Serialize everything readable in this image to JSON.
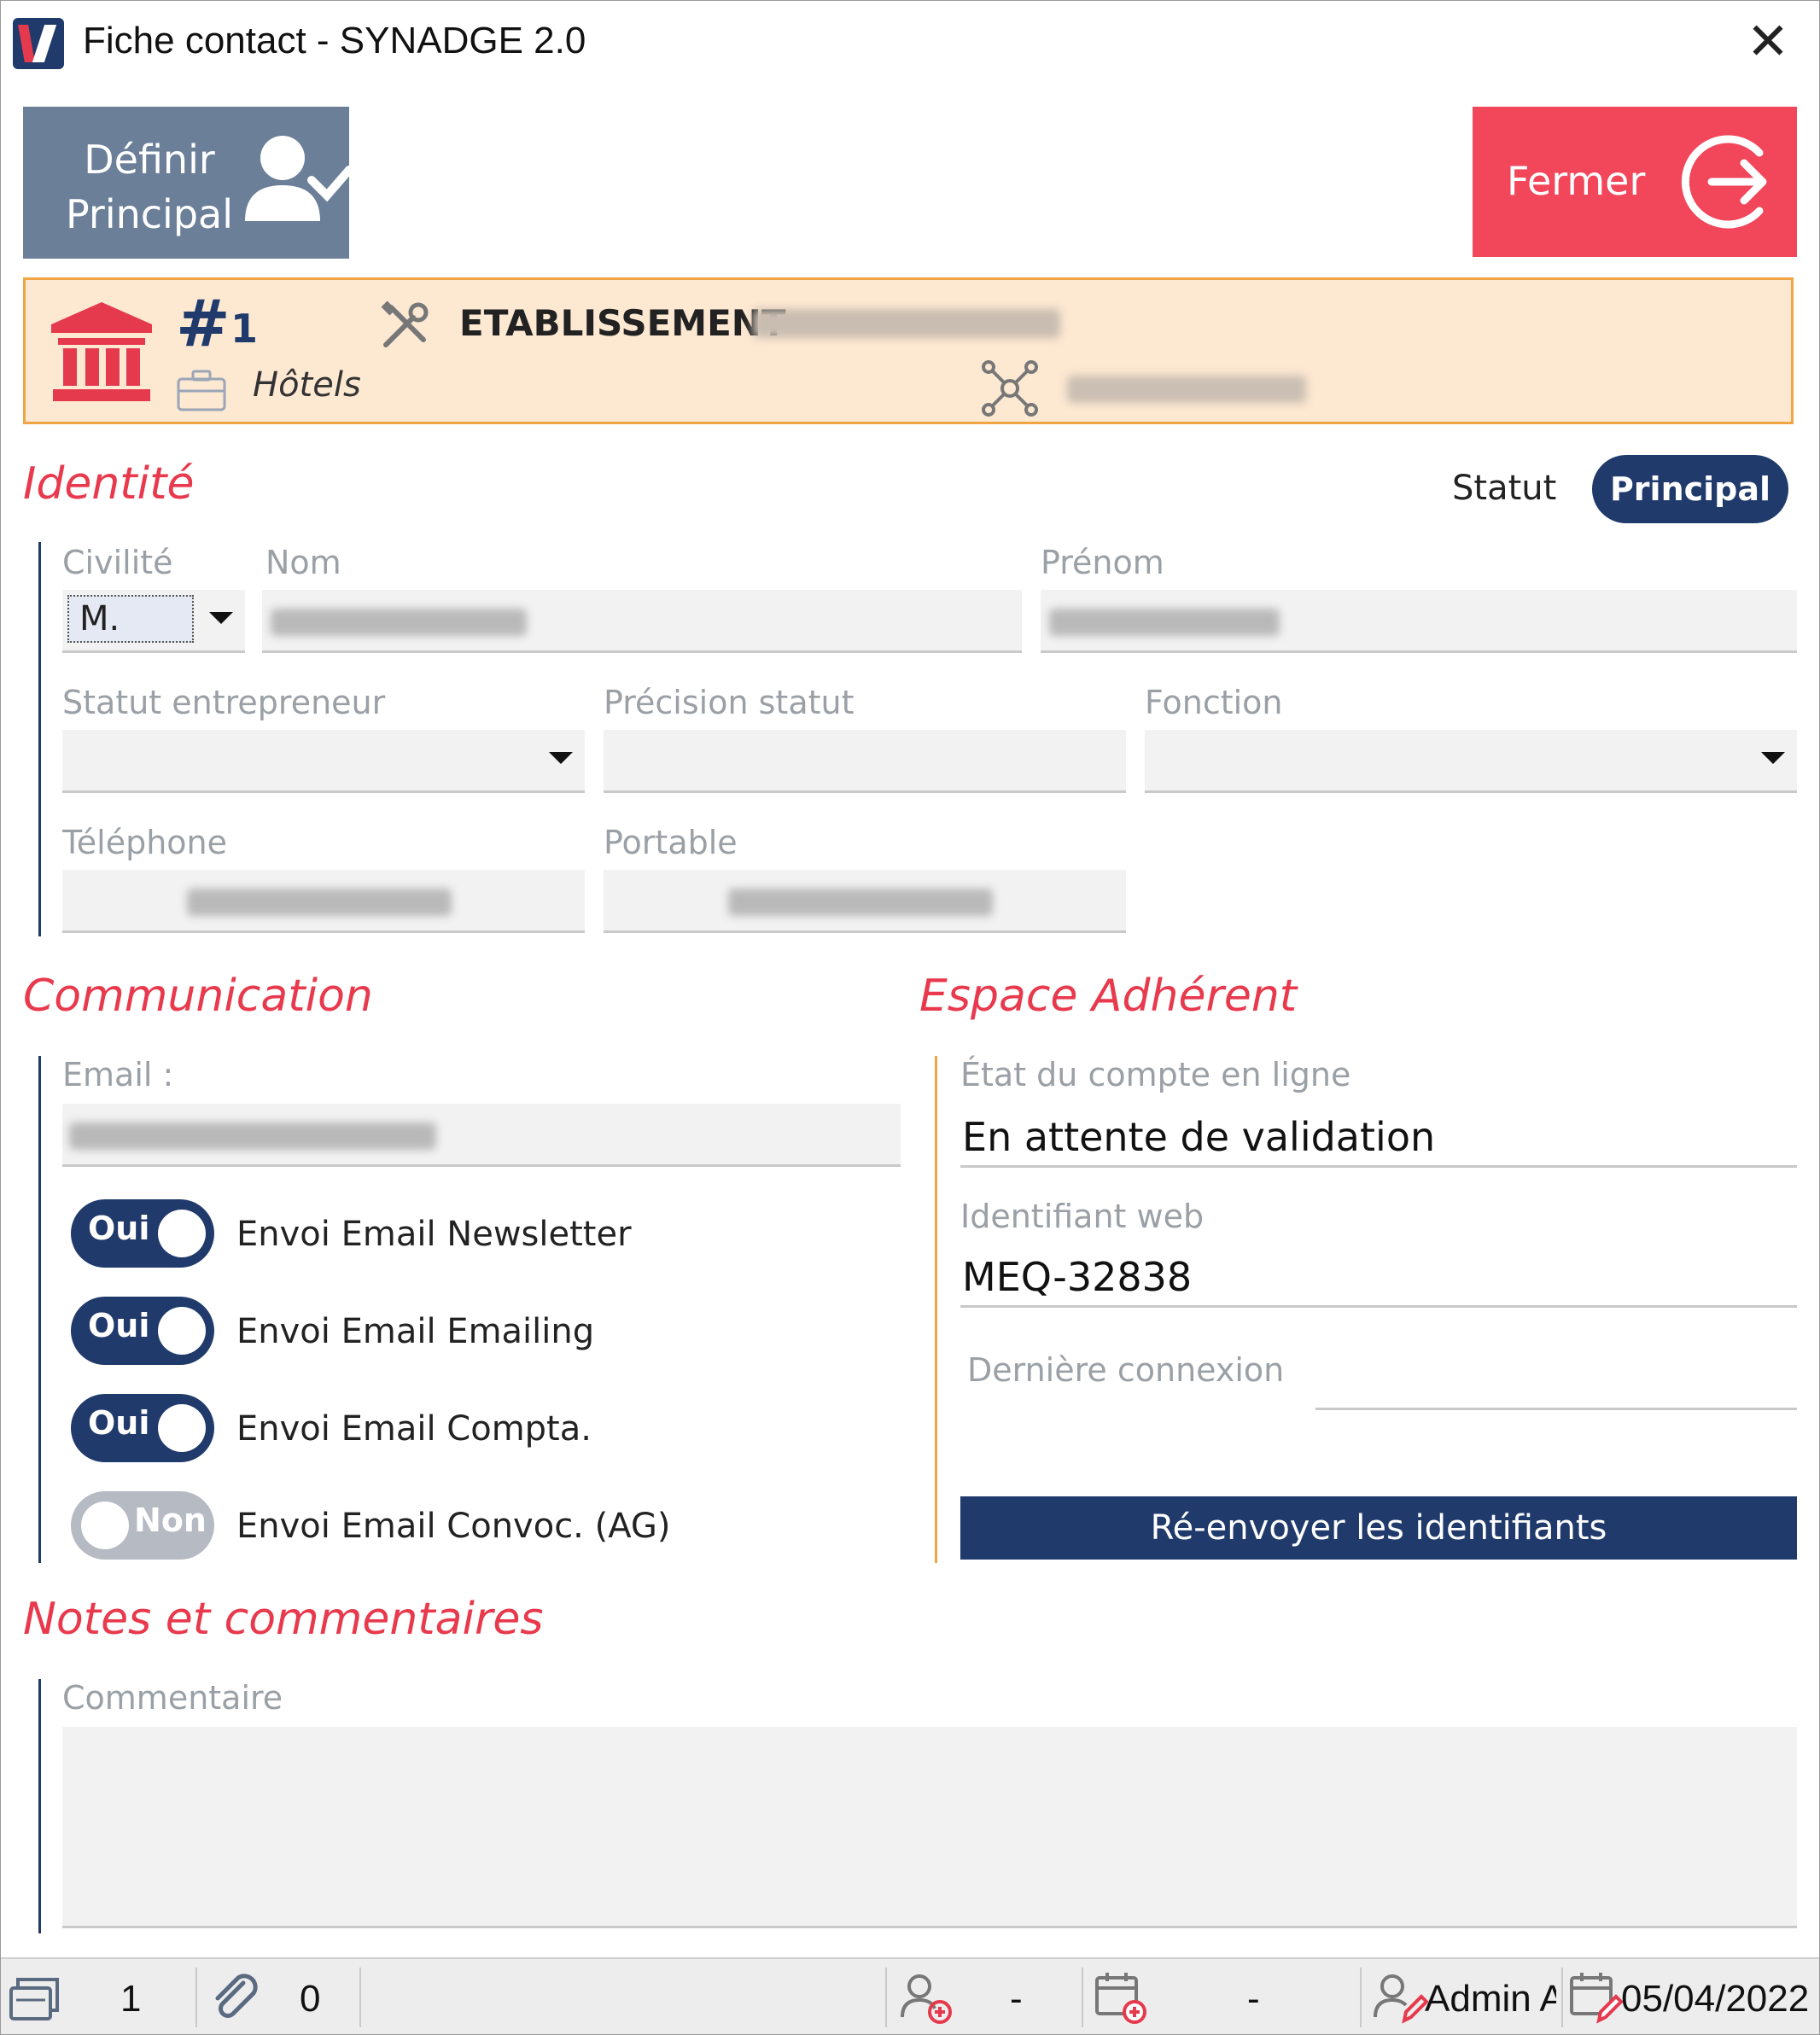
{
  "window": {
    "title": "Fiche contact - SYNADGE 2.0"
  },
  "toolbar": {
    "principal_line1": "Définir",
    "principal_line2": "Principal",
    "fermer_label": "Fermer"
  },
  "etablissement": {
    "hash": "#",
    "number": "1",
    "category": "Hôtels",
    "label": "ETABLISSEMENT"
  },
  "identite": {
    "section_title": "Identité",
    "statut_label": "Statut",
    "statut_value": "Principal",
    "civilite_label": "Civilité",
    "civilite_value": "M.",
    "nom_label": "Nom",
    "prenom_label": "Prénom",
    "statut_entrepreneur_label": "Statut entrepreneur",
    "precision_statut_label": "Précision statut",
    "fonction_label": "Fonction",
    "telephone_label": "Téléphone",
    "portable_label": "Portable"
  },
  "communication": {
    "section_title": "Communication",
    "email_label": "Email :",
    "toggles": [
      {
        "state": "Oui",
        "label": "Envoi Email Newsletter"
      },
      {
        "state": "Oui",
        "label": "Envoi Email Emailing"
      },
      {
        "state": "Oui",
        "label": "Envoi Email Compta."
      },
      {
        "state": "Non",
        "label": "Envoi Email Convoc. (AG)"
      }
    ]
  },
  "espace": {
    "section_title": "Espace Adhérent",
    "etat_label": "État du compte en ligne",
    "etat_value": "En attente de validation",
    "identifiant_label": "Identifiant web",
    "identifiant_value": "MEQ-32838",
    "derniere_label": "Dernière connexion",
    "resend_label": "Ré-envoyer les identifiants"
  },
  "notes": {
    "section_title": "Notes et commentaires",
    "commentaire_label": "Commentaire"
  },
  "statusbar": {
    "documents_count": "1",
    "attachments_count": "0",
    "created_by": "-",
    "created_date": "-",
    "modified_by": "Admin A",
    "modified_date": "05/04/2022"
  },
  "colors": {
    "accent_red": "#f2465a",
    "navy": "#1f3a6b",
    "orange": "#f0a545",
    "section_red": "#e8394d"
  }
}
